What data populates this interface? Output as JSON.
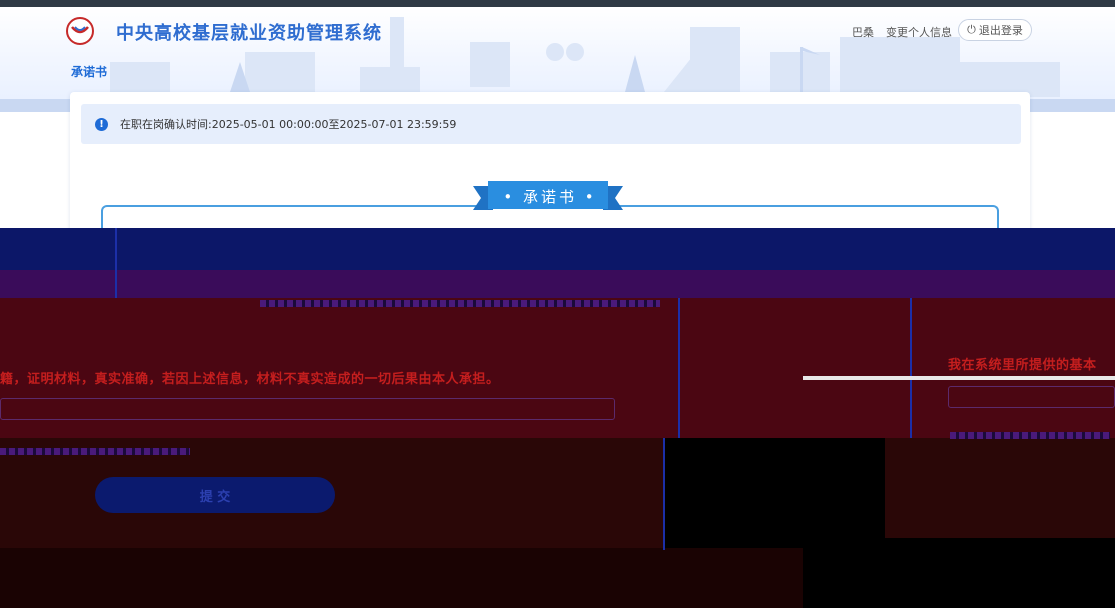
{
  "header": {
    "app_title": "中央高校基层就业资助管理系统",
    "page_tab": "承诺书",
    "user_name": "巴桑",
    "edit_profile_label": "变更个人信息",
    "logout_label": "退出登录",
    "logo_icon": "university-emblem-icon",
    "logout_icon": "power-icon"
  },
  "notice": {
    "icon": "info-icon",
    "text": "在职在岗确认时间:2025-05-01 00:00:00至2025-07-01 23:59:59"
  },
  "letter": {
    "ribbon_title": "•  承诺书  •"
  },
  "garbled": {
    "statement_left": "籍，证明材料，真实准确，若因上述信息，材料不真实造成的一切后果由本人承担。",
    "statement_right": "我在系统里所提供的基本",
    "submit_label": "提 交"
  },
  "colors": {
    "brand_blue": "#2f6dd0",
    "accent_blue": "#1e6bd6",
    "notice_bg": "#e6eefc",
    "ribbon_blue": "#2a8ee0",
    "warning_red": "#c41e1e"
  }
}
